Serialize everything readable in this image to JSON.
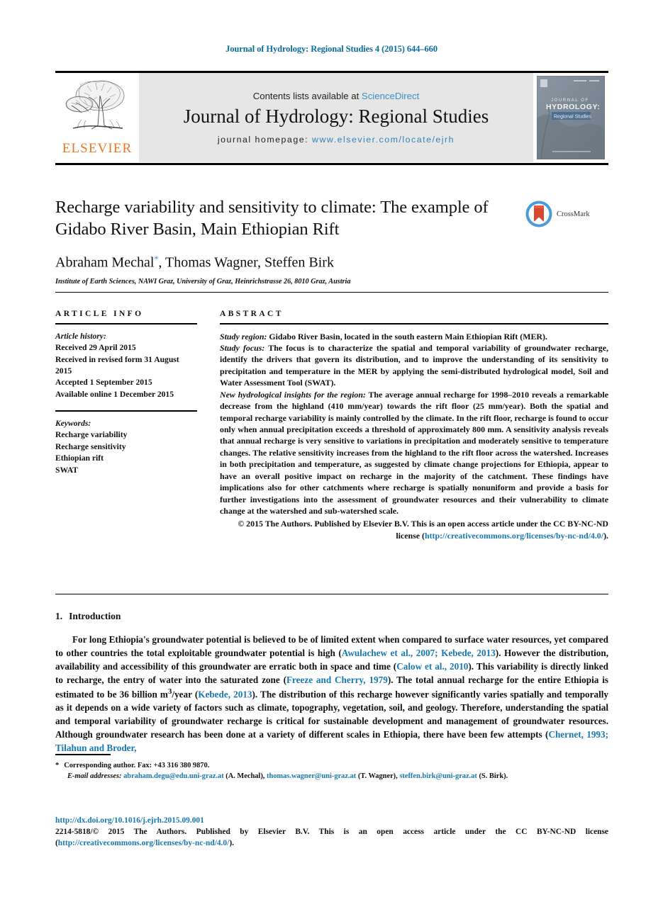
{
  "running_head": "Journal of Hydrology: Regional Studies 4 (2015) 644–660",
  "masthead": {
    "contents_prefix": "Contents lists available at ",
    "sciencedirect": "ScienceDirect",
    "journal_title": "Journal of Hydrology: Regional Studies",
    "homepage_label": "journal homepage:",
    "homepage_url": "www.elsevier.com/locate/ejrh",
    "publisher_logo_word": "ELSEVIER",
    "publisher_logo_icon": "elsevier-tree-icon",
    "cover_title_line1": "JOURNAL OF",
    "cover_title_line2": "HYDROLOGY:",
    "cover_title_line3": "Regional Studies"
  },
  "article": {
    "title": "Recharge variability and sensitivity to climate: The example of Gidabo River Basin, Main Ethiopian Rift",
    "authors": "Abraham Mechal",
    "authors_rest": ", Thomas Wagner, Steffen Birk",
    "author_marker": "*",
    "affiliation": "Institute of Earth Sciences, NAWI Graz, University of Graz, Heinrichstrasse 26, 8010 Graz, Austria",
    "crossmark_label": "CrossMark"
  },
  "article_info": {
    "heading": "ARTICLE INFO",
    "history_label": "Article history:",
    "history": [
      "Received 29 April 2015",
      "Received in revised form 31 August 2015",
      "Accepted 1 September 2015",
      "Available online 1 December 2015"
    ],
    "keywords_label": "Keywords:",
    "keywords": [
      "Recharge variability",
      "Recharge sensitivity",
      "Ethiopian rift",
      "SWAT"
    ]
  },
  "abstract": {
    "heading": "ABSTRACT",
    "study_region_label": "Study region:",
    "study_region_text": " Gidabo River Basin, located in the south eastern Main Ethiopian Rift (MER).",
    "study_focus_label": "Study focus:",
    "study_focus_text": " The focus is to characterize the spatial and temporal variability of groundwater recharge, identify the drivers that govern its distribution, and to improve the understanding of its sensitivity to precipitation and temperature in the MER by applying the semi-distributed hydrological model, Soil and Water Assessment Tool (SWAT).",
    "insights_label": "New hydrological insights for the region:",
    "insights_text": " The average annual recharge for 1998–2010 reveals a remarkable decrease from the highland (410 mm/year) towards the rift floor (25 mm/year). Both the spatial and temporal recharge variability is mainly controlled by the climate. In the rift floor, recharge is found to occur only when annual precipitation exceeds a threshold of approximately 800 mm. A sensitivity analysis reveals that annual recharge is very sensitive to variations in precipitation and moderately sensitive to temperature changes. The relative sensitivity increases from the highland to the rift floor across the watershed. Increases in both precipitation and temperature, as suggested by climate change projections for Ethiopia, appear to have an overall positive impact on recharge in the majority of the catchment. These findings have implications also for other catchments where recharge is spatially nonuniform and provide a basis for further investigations into the assessment of groundwater resources and their vulnerability to climate change at the watershed and sub-watershed scale.",
    "copyright_pre": "© 2015 The Authors. Published by Elsevier B.V. This is an open access article under the CC BY-NC-ND license (",
    "copyright_link": "http://creativecommons.org/licenses/by-nc-nd/4.0/",
    "copyright_post": ")."
  },
  "introduction": {
    "number": "1.",
    "heading": "Introduction",
    "p1_a": "For long Ethiopia's groundwater potential is believed to be of limited extent when compared to surface water resources, yet compared to other countries the total exploitable groundwater potential is high (",
    "ref1": "Awulachew et al., 2007; Kebede, 2013",
    "p1_b": "). However the distribution, availability and accessibility of this groundwater are erratic both in space and time (",
    "ref2": "Calow et al., 2010",
    "p1_c": "). This variability is directly linked to recharge, the entry of water into the saturated zone (",
    "ref3": "Freeze and Cherry, 1979",
    "p1_d": "). The total annual recharge for the entire Ethiopia is estimated to be 36 billion m",
    "p1_sup": "3",
    "p1_e": "/year (",
    "ref4": "Kebede, 2013",
    "p1_f": "). The distribution of this recharge however significantly varies spatially and temporally as it depends on a wide variety of factors such as climate, topography, vegetation, soil, and geology. Therefore, understanding the spatial and temporal variability of groundwater recharge is critical for sustainable development and management of groundwater resources. Although groundwater research has been done at a variety of different scales in Ethiopia, there have been few attempts (",
    "ref5": "Chernet, 1993; Tilahun and Broder,"
  },
  "footnote": {
    "star": "*",
    "corresponding": "Corresponding author. Fax: +43 316 380 9870.",
    "email_label": "E-mail addresses:",
    "email1": "abraham.degu@edu.uni-graz.at",
    "email1_name": " (A. Mechal), ",
    "email2": "thomas.wagner@uni-graz.at",
    "email2_name": " (T. Wagner), ",
    "email3": "steffen.birk@uni-graz.at",
    "email3_name": " (S. Birk)."
  },
  "footer": {
    "doi": "http://dx.doi.org/10.1016/j.ejrh.2015.09.001",
    "issn_line": "2214-5818/© 2015 The Authors. Published by Elsevier B.V. This is an open access article under the CC BY-NC-ND license (",
    "license_link": "http://creativecommons.org/licenses/by-nc-nd/4.0/",
    "license_post": ")."
  },
  "colors": {
    "link_blue": "#1878b0",
    "sciencedirect_blue": "#3a90c4",
    "elsevier_orange": "#e87722",
    "running_head_blue": "#0b6d9e",
    "masthead_gray": "#e6e6e6"
  }
}
